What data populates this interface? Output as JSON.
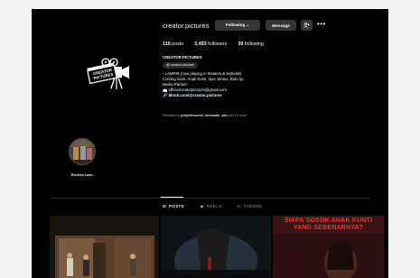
{
  "profile": {
    "username": "creator.pictures",
    "following_button": "Following ⌄",
    "message_button": "Message",
    "more_label": "•••",
    "stats": {
      "posts_count": "110",
      "posts_label": "posts",
      "followers_count": "3,493",
      "followers_label": "followers",
      "following_count": "39",
      "following_label": "following"
    },
    "display_name": "CREATOR PICTURES",
    "threads_handle": "creator.pictures",
    "bio_lines": [
      "- LAMPIR (now playing in theaters & festivals)",
      "Coming soon: Anak Kunti, Iyus Jentus, Buto Ijo",
      "Media Partner:",
      "📩 officialcreatorpictures@gmail.com"
    ],
    "link": "tiktok.com/@creator.pictures",
    "followed_by_prefix": "Followed by",
    "followed_by_names": "joeljeffersonst, alexander_aan",
    "followed_by_suffix": "and 12 more",
    "logo_text": [
      "CREATOR",
      "PICTURES"
    ]
  },
  "highlights": [
    {
      "label": "Review Lam..."
    }
  ],
  "tabs": [
    {
      "icon": "⊞",
      "label": "POSTS",
      "active": true
    },
    {
      "icon": "▣",
      "label": "REELS",
      "active": false
    },
    {
      "icon": "☷",
      "label": "TAGGED",
      "active": false
    }
  ],
  "posts": [
    {
      "overlay_text": ""
    },
    {
      "overlay_text": ""
    },
    {
      "overlay_text": [
        "SIAPA SOSOK ANAK KUNTI",
        "YANG SEBENARNYA?"
      ]
    }
  ],
  "colors": {
    "background": "#000000",
    "button": "#363636",
    "muted_text": "#a8a8a8",
    "overlay_red": "#ff2a2a"
  }
}
